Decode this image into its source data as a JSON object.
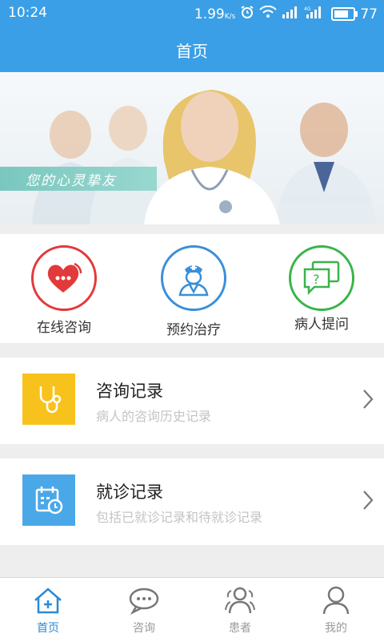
{
  "status_bar": {
    "time": "10:24",
    "speed": "1.99",
    "speed_unit": "K/s",
    "battery": "77",
    "battery_level": 0.77
  },
  "header": {
    "title": "首页"
  },
  "banner": {
    "slogan": "您的心灵挚友"
  },
  "quick_actions": [
    {
      "label": "在线咨询",
      "icon": "heart-chat-icon",
      "color": "#e23a3a"
    },
    {
      "label": "预约治疗",
      "icon": "nurse-icon",
      "color": "#3a8fd9"
    },
    {
      "label": "病人提问",
      "icon": "question-chat-icon",
      "color": "#3ab44a"
    }
  ],
  "records": [
    {
      "title": "咨询记录",
      "subtitle": "病人的咨询历史记录",
      "icon": "stethoscope-icon",
      "color": "#f8c21c"
    },
    {
      "title": "就诊记录",
      "subtitle": "包括已就诊记录和待就诊记录",
      "icon": "calendar-clock-icon",
      "color": "#4aa8e8"
    }
  ],
  "tabs": [
    {
      "label": "首页",
      "icon": "home-icon",
      "active": true
    },
    {
      "label": "咨询",
      "icon": "chat-icon",
      "active": false
    },
    {
      "label": "患者",
      "icon": "patients-icon",
      "active": false
    },
    {
      "label": "我的",
      "icon": "profile-icon",
      "active": false
    }
  ]
}
